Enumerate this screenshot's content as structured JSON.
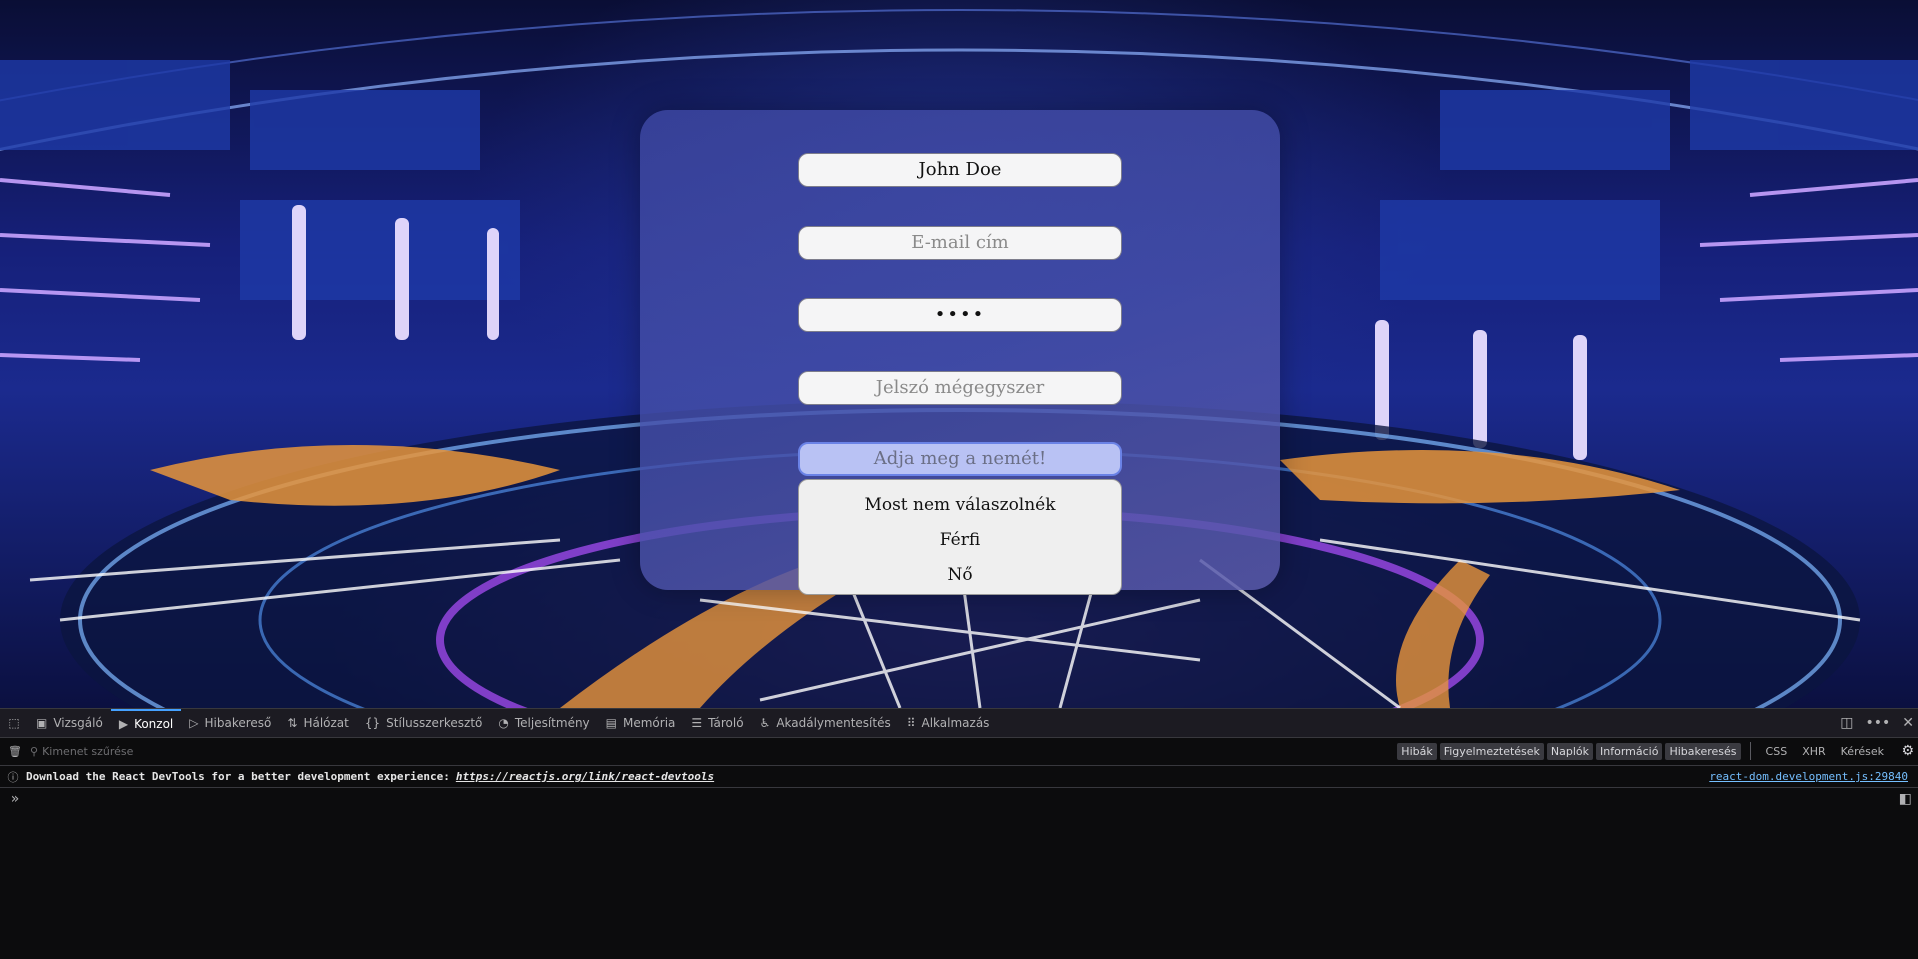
{
  "form": {
    "name_value": "John Doe",
    "email_placeholder": "E-mail cím",
    "password_masked": "••••",
    "password_confirm_placeholder": "Jelszó mégegyszer",
    "gender_placeholder": "Adja meg a nemét!",
    "gender_options": [
      "Most nem válaszolnék",
      "Férfi",
      "Nő"
    ]
  },
  "devtools": {
    "tabs": [
      {
        "label": "Vizsgáló",
        "icon": "inspector-icon"
      },
      {
        "label": "Konzol",
        "icon": "console-icon",
        "active": true
      },
      {
        "label": "Hibakereső",
        "icon": "debugger-icon"
      },
      {
        "label": "Hálózat",
        "icon": "network-icon"
      },
      {
        "label": "Stílusszerkesztő",
        "icon": "style-editor-icon"
      },
      {
        "label": "Teljesítmény",
        "icon": "performance-icon"
      },
      {
        "label": "Memória",
        "icon": "memory-icon"
      },
      {
        "label": "Tároló",
        "icon": "storage-icon"
      },
      {
        "label": "Akadálymentesítés",
        "icon": "accessibility-icon"
      },
      {
        "label": "Alkalmazás",
        "icon": "application-icon"
      }
    ],
    "filter_placeholder": "Kimenet szűrése",
    "filter_pills": [
      "Hibák",
      "Figyelmeztetések",
      "Naplók",
      "Információ",
      "Hibakeresés"
    ],
    "filter_plain": [
      "CSS",
      "XHR",
      "Kérések"
    ],
    "message": {
      "text": "Download the React DevTools for a better development experience:",
      "link": "https://reactjs.org/link/react-devtools",
      "source": "react-dom.development.js:29840"
    },
    "colors": {
      "accent": "#45a1ff",
      "panel_bg": "#0c0c0d"
    }
  }
}
